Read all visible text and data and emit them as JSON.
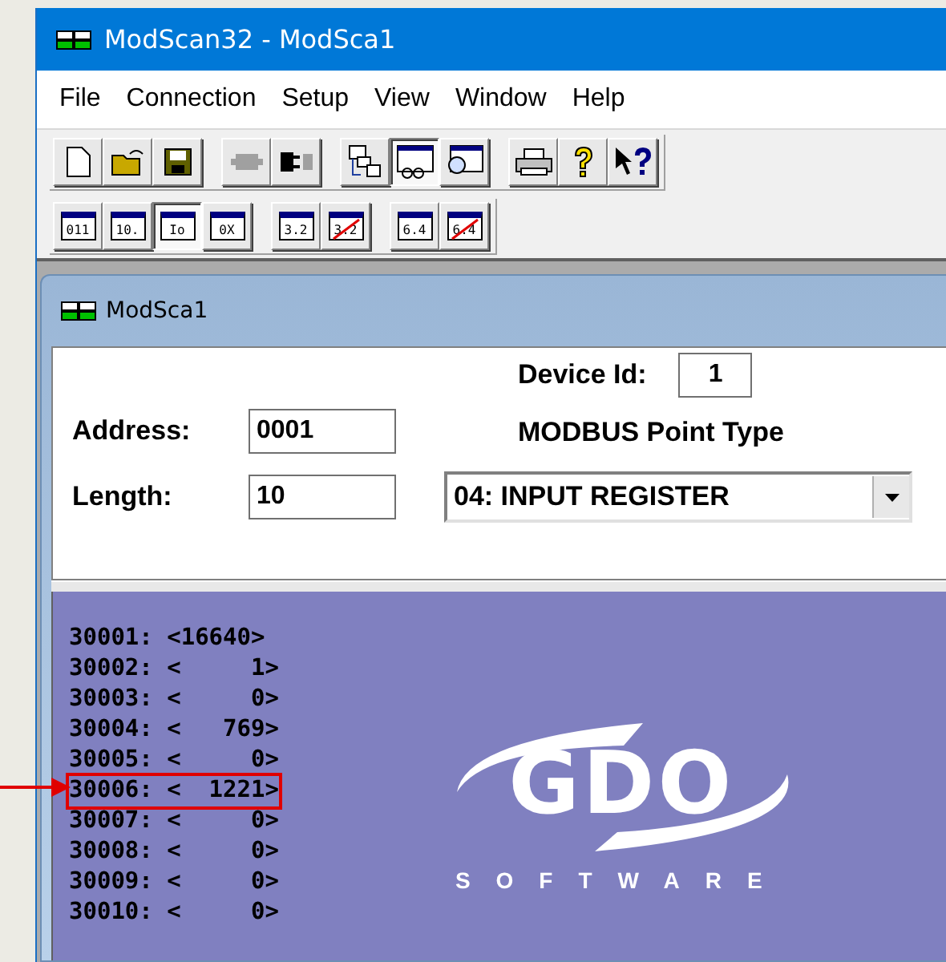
{
  "window": {
    "title": "ModScan32 - ModSca1"
  },
  "menu": [
    "File",
    "Connection",
    "Setup",
    "View",
    "Window",
    "Help"
  ],
  "toolbar": [
    {
      "kind": "new",
      "pressed": false
    },
    {
      "kind": "open",
      "pressed": false
    },
    {
      "kind": "save",
      "pressed": false
    },
    {
      "kind": "sep"
    },
    {
      "kind": "connect",
      "pressed": false,
      "disabled": true
    },
    {
      "kind": "disconnect",
      "pressed": false,
      "disabled": false
    },
    {
      "kind": "sep"
    },
    {
      "kind": "tree",
      "pressed": false
    },
    {
      "kind": "display",
      "pressed": true
    },
    {
      "kind": "inspect",
      "pressed": false
    },
    {
      "kind": "sep"
    },
    {
      "kind": "print",
      "pressed": false
    },
    {
      "kind": "help",
      "pressed": false
    },
    {
      "kind": "context-help",
      "pressed": false
    }
  ],
  "format_toolbar": [
    {
      "kind": "format",
      "label": "011",
      "pressed": false,
      "struck": false
    },
    {
      "kind": "format",
      "label": "10.",
      "pressed": false,
      "struck": false
    },
    {
      "kind": "format",
      "label": "Io",
      "pressed": true,
      "struck": false
    },
    {
      "kind": "format",
      "label": "0X",
      "pressed": false,
      "struck": false
    },
    {
      "kind": "sep"
    },
    {
      "kind": "format",
      "label": "3.2",
      "pressed": false,
      "struck": false
    },
    {
      "kind": "format",
      "label": "3.2",
      "pressed": false,
      "struck": true
    },
    {
      "kind": "sep"
    },
    {
      "kind": "format",
      "label": "6.4",
      "pressed": false,
      "struck": false
    },
    {
      "kind": "format",
      "label": "6.4",
      "pressed": false,
      "struck": true
    }
  ],
  "child": {
    "title": "ModSca1",
    "address": {
      "label": "Address:",
      "value": "0001"
    },
    "length": {
      "label": "Length:",
      "value": "10"
    },
    "device_id": {
      "label": "Device Id:",
      "value": "1"
    },
    "point_type": {
      "label": "MODBUS Point Type",
      "value": "04: INPUT REGISTER"
    },
    "registers": [
      {
        "text": "30001: <16640>",
        "highlighted": false
      },
      {
        "text": "30002: <     1>",
        "highlighted": false
      },
      {
        "text": "30003: <     0>",
        "highlighted": false
      },
      {
        "text": "30004: <   769>",
        "highlighted": false
      },
      {
        "text": "30005: <     0>",
        "highlighted": false
      },
      {
        "text": "30006: <  1221>",
        "highlighted": true
      },
      {
        "text": "30007: <     0>",
        "highlighted": false
      },
      {
        "text": "30008: <     0>",
        "highlighted": false
      },
      {
        "text": "30009: <     0>",
        "highlighted": false
      },
      {
        "text": "30010: <     0>",
        "highlighted": false
      }
    ],
    "logo": {
      "name": "GDO",
      "tagline": "SOFTWARE"
    }
  }
}
